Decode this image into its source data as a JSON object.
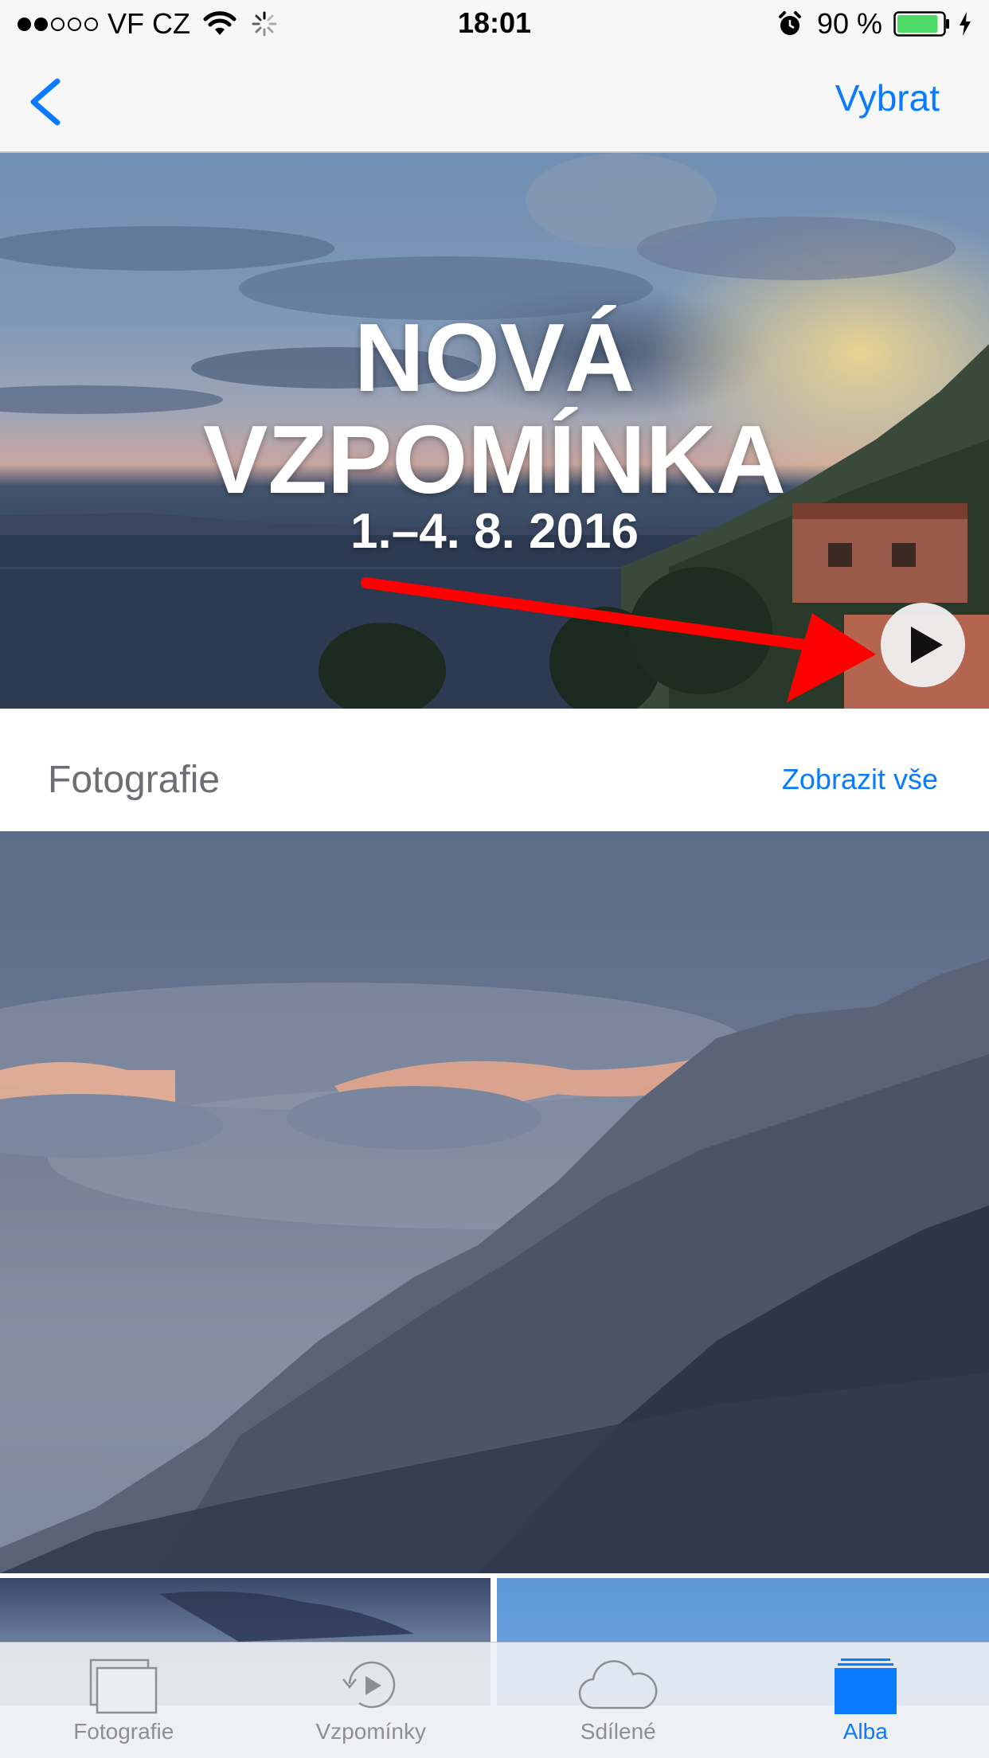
{
  "status_bar": {
    "signal_dots": [
      true,
      true,
      false,
      false,
      false
    ],
    "carrier": "VF CZ",
    "time": "18:01",
    "battery_percent": "90 %",
    "battery_level": 0.9,
    "colors": {
      "battery": "#4cd964"
    }
  },
  "nav": {
    "back_icon": "chevron-left-icon",
    "select_label": "Vybrat"
  },
  "memory": {
    "title_line1": "NOVÁ",
    "title_line2": "VZPOMÍNKA",
    "date_range": "1.–4. 8. 2016",
    "play_icon": "play-icon"
  },
  "photos_section": {
    "title": "Fotografie",
    "show_all_label": "Zobrazit vše"
  },
  "tabs": [
    {
      "label": "Fotografie",
      "icon": "photos-icon",
      "active": false
    },
    {
      "label": "Vzpomínky",
      "icon": "memories-icon",
      "active": false
    },
    {
      "label": "Sdílené",
      "icon": "cloud-icon",
      "active": false
    },
    {
      "label": "Alba",
      "icon": "albums-icon",
      "active": true
    }
  ],
  "colors": {
    "accent": "#0a7afe",
    "annotation_arrow": "#ff0000"
  }
}
